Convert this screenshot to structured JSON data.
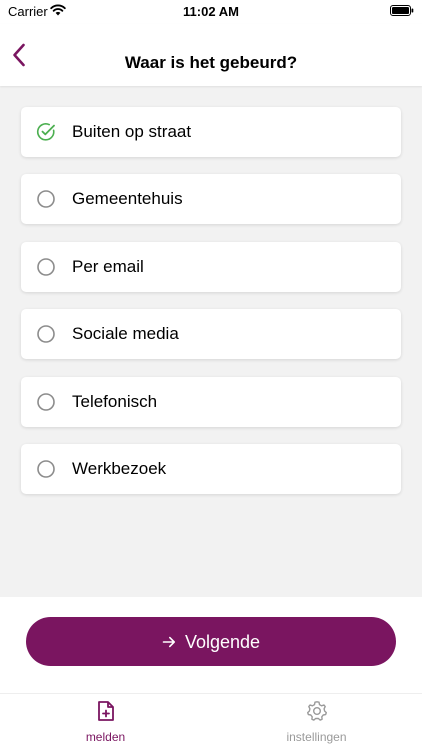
{
  "status_bar": {
    "carrier": "Carrier",
    "time": "11:02 AM",
    "wifi_icon": "wifi-icon",
    "battery_icon": "battery-icon"
  },
  "header": {
    "title": "Waar is het gebeurd?",
    "back_icon": "chevron-left-icon"
  },
  "options": [
    {
      "label": "Buiten op straat",
      "selected": true
    },
    {
      "label": "Gemeentehuis",
      "selected": false
    },
    {
      "label": "Per email",
      "selected": false
    },
    {
      "label": "Sociale media",
      "selected": false
    },
    {
      "label": "Telefonisch",
      "selected": false
    },
    {
      "label": "Werkbezoek",
      "selected": false
    }
  ],
  "next_button": {
    "label": "Volgende",
    "icon": "arrow-right-icon"
  },
  "tabs": [
    {
      "label": "melden",
      "icon": "file-plus-icon",
      "active": true
    },
    {
      "label": "instellingen",
      "icon": "gear-icon",
      "active": false
    }
  ],
  "colors": {
    "accent": "#7a1560",
    "check": "#4caf50",
    "background": "#f2f2f2",
    "inactive": "#9a9a9a"
  }
}
